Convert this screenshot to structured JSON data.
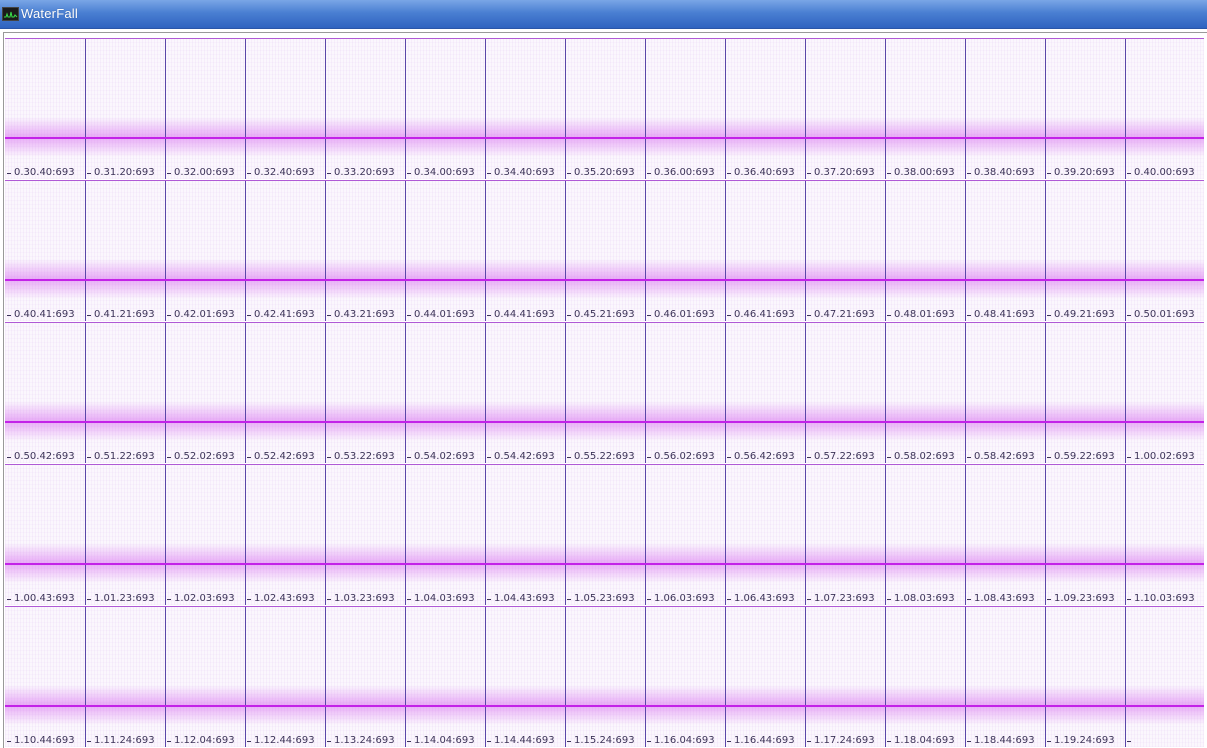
{
  "window": {
    "title": "WaterFall",
    "icon": "waveform-icon"
  },
  "colors": {
    "titlebar_top": "#7aa6e6",
    "titlebar_bottom": "#2f63c0",
    "trace": "#c323e8",
    "row_border": "#b05ad6",
    "divider": "#5b46a8",
    "label_text": "#3c3358"
  },
  "rows": [
    {
      "labels": [
        "0.30.40:693",
        "0.31.20:693",
        "0.32.00:693",
        "0.32.40:693",
        "0.33.20:693",
        "0.34.00:693",
        "0.34.40:693",
        "0.35.20:693",
        "0.36.00:693",
        "0.36.40:693",
        "0.37.20:693",
        "0.38.00:693",
        "0.38.40:693",
        "0.39.20:693",
        "0.40.00:693"
      ]
    },
    {
      "labels": [
        "0.40.41:693",
        "0.41.21:693",
        "0.42.01:693",
        "0.42.41:693",
        "0.43.21:693",
        "0.44.01:693",
        "0.44.41:693",
        "0.45.21:693",
        "0.46.01:693",
        "0.46.41:693",
        "0.47.21:693",
        "0.48.01:693",
        "0.48.41:693",
        "0.49.21:693",
        "0.50.01:693"
      ]
    },
    {
      "labels": [
        "0.50.42:693",
        "0.51.22:693",
        "0.52.02:693",
        "0.52.42:693",
        "0.53.22:693",
        "0.54.02:693",
        "0.54.42:693",
        "0.55.22:693",
        "0.56.02:693",
        "0.56.42:693",
        "0.57.22:693",
        "0.58.02:693",
        "0.58.42:693",
        "0.59.22:693",
        "1.00.02:693"
      ]
    },
    {
      "labels": [
        "1.00.43:693",
        "1.01.23:693",
        "1.02.03:693",
        "1.02.43:693",
        "1.03.23:693",
        "1.04.03:693",
        "1.04.43:693",
        "1.05.23:693",
        "1.06.03:693",
        "1.06.43:693",
        "1.07.23:693",
        "1.08.03:693",
        "1.08.43:693",
        "1.09.23:693",
        "1.10.03:693"
      ]
    },
    {
      "labels": [
        "1.10.44:693",
        "1.11.24:693",
        "1.12.04:693",
        "1.12.44:693",
        "1.13.24:693",
        "1.14.04:693",
        "1.14.44:693",
        "1.15.24:693",
        "1.16.04:693",
        "1.16.44:693",
        "1.17.24:693",
        "1.18.04:693",
        "1.18.44:693",
        "1.19.24:693",
        ""
      ]
    }
  ]
}
